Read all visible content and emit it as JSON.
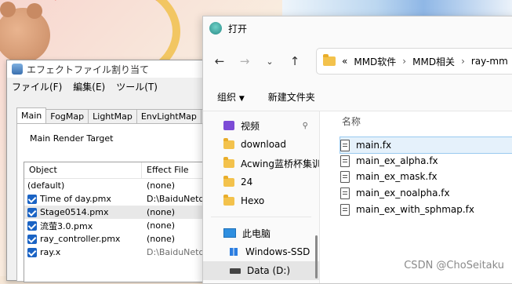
{
  "effect_window": {
    "title": "エフェクトファイル割り当て",
    "menu": [
      "ファイル(F)",
      "編集(E)",
      "ツール(T)"
    ],
    "tabs": [
      "Main",
      "FogMap",
      "LightMap",
      "EnvLightMap",
      "Ma"
    ],
    "render_target_label": "Main Render Target",
    "columns": [
      "Object",
      "Effect File"
    ],
    "rows": [
      {
        "name": "(default)",
        "effect": "(none)",
        "checked": false
      },
      {
        "name": "Time of day.pmx",
        "effect": "D:\\BaiduNetdisk",
        "checked": true
      },
      {
        "name": "Stage0514.pmx",
        "effect": "(none)",
        "checked": true
      },
      {
        "name": "流萤3.0.pmx",
        "effect": "(none)",
        "checked": true
      },
      {
        "name": "ray_controller.pmx",
        "effect": "(none)",
        "checked": true
      },
      {
        "name": "ray.x",
        "effect": "D:\\BaiduNetdisk",
        "checked": true
      }
    ]
  },
  "file_dialog": {
    "title": "打开",
    "address": {
      "prefix": "«",
      "crumbs": [
        "MMD软件",
        "MMD相关",
        "ray-mm"
      ]
    },
    "toolbar": {
      "organize": "组织",
      "new_folder": "新建文件夹"
    },
    "nav": {
      "videos": "视频",
      "folders": [
        "download",
        "Acwing蓝桥杯集训",
        "24",
        "Hexo"
      ],
      "this_pc": "此电脑",
      "drive_c": "Windows-SSD",
      "drive_d": "Data (D:)"
    },
    "name_column": "名称",
    "files": [
      "main.fx",
      "main_ex_alpha.fx",
      "main_ex_mask.fx",
      "main_ex_noalpha.fx",
      "main_ex_with_sphmap.fx"
    ]
  },
  "watermark": "CSDN @ChoSeitaku"
}
